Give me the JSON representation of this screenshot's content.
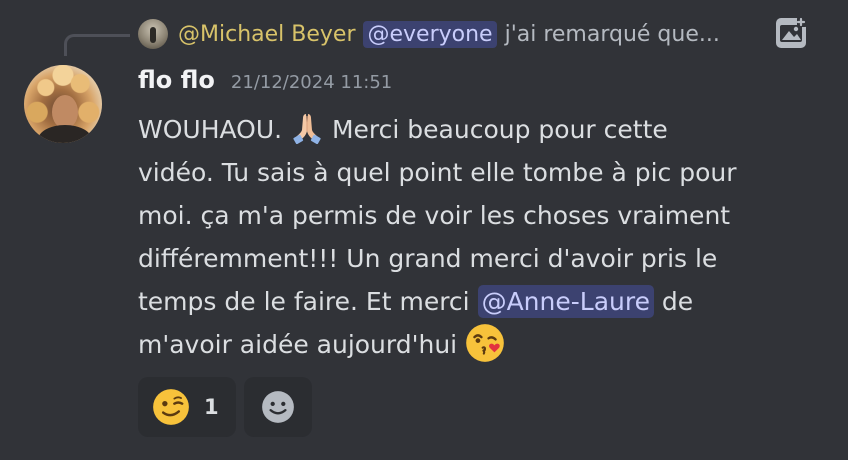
{
  "reply": {
    "author": "@Michael Beyer",
    "mention": "@everyone",
    "preview": "j'ai remarqué que..."
  },
  "message": {
    "author": "flo flo",
    "timestamp": "21/12/2024 11:51",
    "lines": [
      {
        "a": "WOUHAOU. ",
        "b": " Merci beaucoup pour cette"
      },
      "vidéo. Tu sais à quel point elle tombe à pic pour",
      "moi. ça m'a permis de voir les choses vraiment",
      "différemment!!! Un grand merci d'avoir pris le",
      {
        "a": "temps de le faire. Et merci ",
        "mention": "@Anne-Laure",
        "b": " de"
      },
      {
        "a": "m'avoir aidée aujourd'hui "
      }
    ],
    "emojis": [
      "folded-hands-emoji",
      "face-blowing-kiss-emoji"
    ]
  },
  "reactions": [
    {
      "emoji": "winking-face-emoji",
      "count": "1"
    }
  ],
  "icons": {
    "reply_image": "image-icon",
    "add_reaction": "add-reaction-smiley-icon"
  },
  "colors": {
    "background": "#313338",
    "reply_author": "#d8c36a",
    "mention_bg": "#3c4270",
    "mention_text": "#c9cdfb",
    "reaction_bg": "#2b2d31"
  }
}
